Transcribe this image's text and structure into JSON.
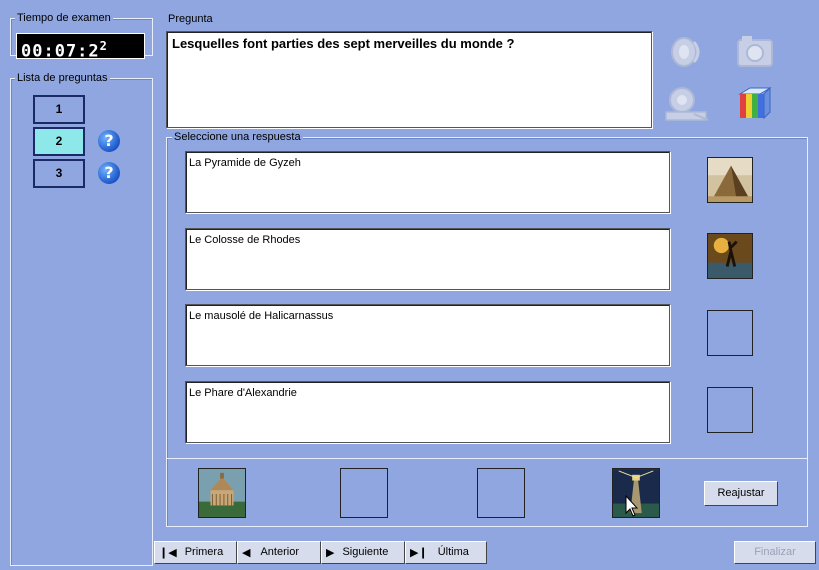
{
  "timer": {
    "legend": "Tiempo de examen",
    "value": "00:07:2",
    "superscript": "2"
  },
  "question_list": {
    "legend": "Lista de preguntas",
    "items": [
      {
        "label": "1",
        "active": false,
        "flag": false
      },
      {
        "label": "2",
        "active": true,
        "flag": true
      },
      {
        "label": "3",
        "active": false,
        "flag": true
      }
    ],
    "flag_glyph": "?"
  },
  "question": {
    "legend": "Pregunta",
    "text": "Lesquelles font parties des sept merveilles du monde ?"
  },
  "media_icons": [
    "sound-icon",
    "camera-icon",
    "video-icon",
    "color-palette-icon"
  ],
  "answers": {
    "legend": "Seleccione una respuesta",
    "items": [
      {
        "text": "La Pyramide de Gyzeh",
        "image": "pyramid"
      },
      {
        "text": "Le Colosse de Rhodes",
        "image": "colossus"
      },
      {
        "text": "Le mausolé de Halicarnassus",
        "image": ""
      },
      {
        "text": "Le Phare d'Alexandrie",
        "image": ""
      }
    ]
  },
  "drag_images": [
    "mausoleum",
    "",
    "",
    "lighthouse"
  ],
  "reset_label": "Reajustar",
  "nav": {
    "first": "Primera",
    "prev": "Anterior",
    "next": "Siguiente",
    "last": "Última"
  },
  "finish_label": "Finalizar",
  "colors": {
    "background": "#8fa6e0",
    "active_question": "#8ee8ea",
    "timer_bg": "#000000"
  }
}
